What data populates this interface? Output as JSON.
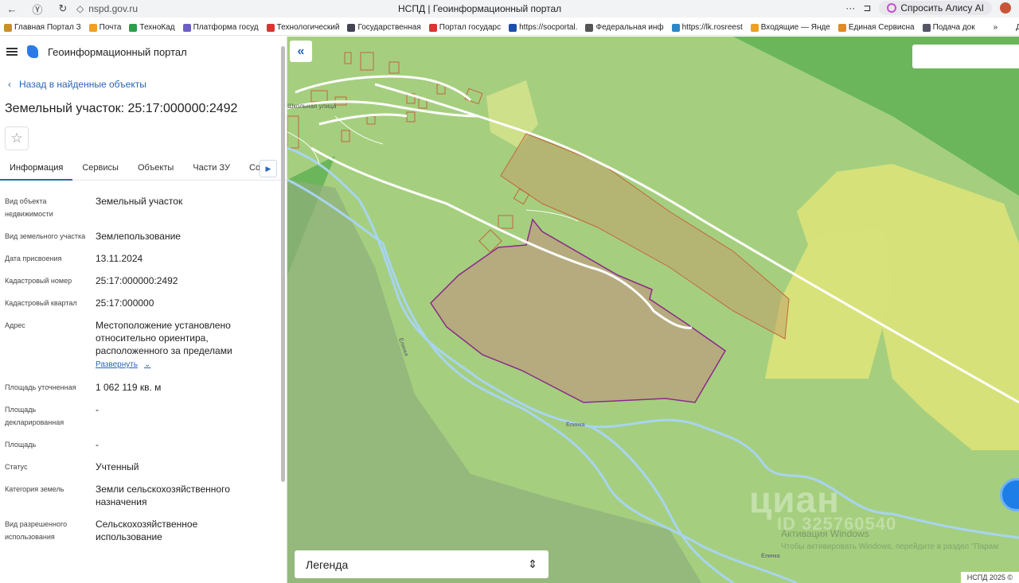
{
  "browser": {
    "url": "nspd.gov.ru",
    "page_title": "НСПД | Геоинформационный портал",
    "alice_label": "Спросить Алису AI",
    "more": "···"
  },
  "bookmarks": [
    {
      "label": "Главная Портал З",
      "color": "#c8912a"
    },
    {
      "label": "Почта",
      "color": "#f0a020"
    },
    {
      "label": "ТехноКад",
      "color": "#2aa04a"
    },
    {
      "label": "Платформа госуд",
      "color": "#6b5fc7"
    },
    {
      "label": "Технологический",
      "color": "#d33"
    },
    {
      "label": "Государственная",
      "color": "#445"
    },
    {
      "label": "Портал государс",
      "color": "#d33"
    },
    {
      "label": "https://socportal.",
      "color": "#1e4fa8"
    },
    {
      "label": "Федеральная инф",
      "color": "#555"
    },
    {
      "label": "https://lk.rosreest",
      "color": "#2a88c8"
    },
    {
      "label": "Входящие — Янде",
      "color": "#f0a020"
    },
    {
      "label": "Единая Сервисна",
      "color": "#e08a2a"
    },
    {
      "label": "Подача док",
      "color": "#556"
    },
    {
      "label": "»",
      "color": "transparent"
    },
    {
      "label": "Друг",
      "color": "transparent"
    }
  ],
  "panel": {
    "portal_title": "Геоинформационный портал",
    "back_label": "Назад в найденные объекты",
    "object_title": "Земельный участок: 25:17:000000:2492",
    "tabs": [
      "Информация",
      "Сервисы",
      "Объекты",
      "Части ЗУ",
      "Соста"
    ],
    "expand_label": "Развернуть",
    "fields": [
      {
        "k": "Вид объекта недвижимости",
        "v": "Земельный участок"
      },
      {
        "k": "Вид земельного участка",
        "v": "Землепользование"
      },
      {
        "k": "Дата присвоения",
        "v": "13.11.2024"
      },
      {
        "k": "Кадастровый номер",
        "v": "25:17:000000:2492"
      },
      {
        "k": "Кадастровый квартал",
        "v": "25:17:000000"
      },
      {
        "k": "Адрес",
        "v": "Местоположение установлено относительно ориентира, расположенного за пределами"
      },
      {
        "k": "Площадь уточненная",
        "v": "1 062 119 кв. м"
      },
      {
        "k": "Площадь декларированная",
        "v": "-"
      },
      {
        "k": "Площадь",
        "v": "-"
      },
      {
        "k": "Статус",
        "v": "Учтенный"
      },
      {
        "k": "Категория земель",
        "v": "Земли сельскохозяйственного назначения"
      },
      {
        "k": "Вид разрешенного использования",
        "v": "Сельскохозяйственное использование"
      }
    ]
  },
  "map": {
    "legend_label": "Легенда",
    "copyright": "НСПД 2025 ©",
    "river_label": "Ёлинка",
    "street_label": "Школьная улица",
    "watermark": "циан",
    "watermark_id": "ID 325760540",
    "activation_title": "Активация Windows",
    "activation_text": "Чтобы активировать Windows, перейдите в раздел \"Парам",
    "colors": {
      "base": "#a5cf7e",
      "parcel_fill": "#b7a57e",
      "parcel_stroke": "#8a2a8a",
      "yellow": "#d8e27a",
      "dark_green": "#6bb65a",
      "river": "#a8d4f0"
    }
  }
}
